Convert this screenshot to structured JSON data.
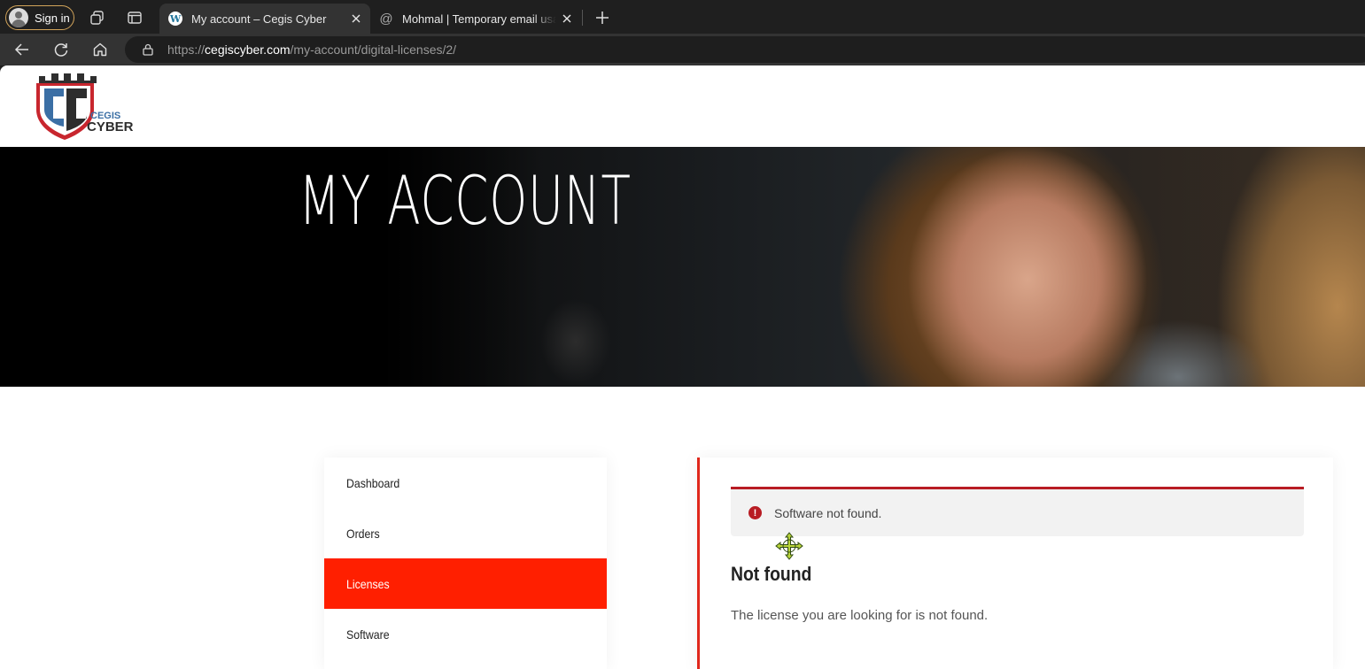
{
  "browser": {
    "signin_label": "Sign in",
    "tabs": [
      {
        "title": "My account – Cegis Cyber",
        "favicon": "wordpress-icon",
        "active": true
      },
      {
        "title": "Mohmal | Temporary email usa email",
        "favicon": "at-icon",
        "active": false
      }
    ],
    "address": {
      "protocol": "https://",
      "host": "cegiscyber.com",
      "path": "/my-account/digital-licenses/2/"
    }
  },
  "site": {
    "logo_text_top": "CEGIS",
    "logo_text_bottom": "CYBER"
  },
  "hero": {
    "title": "MY ACCOUNT"
  },
  "account_nav": {
    "items": [
      {
        "label": "Dashboard",
        "active": false
      },
      {
        "label": "Orders",
        "active": false
      },
      {
        "label": "Licenses",
        "active": true
      },
      {
        "label": "Software",
        "active": false
      }
    ]
  },
  "content": {
    "notice": "Software not found.",
    "title": "Not found",
    "message": "The license you are looking for is not found."
  },
  "colors": {
    "accent": "#ff1f00",
    "error": "#b81c23"
  }
}
